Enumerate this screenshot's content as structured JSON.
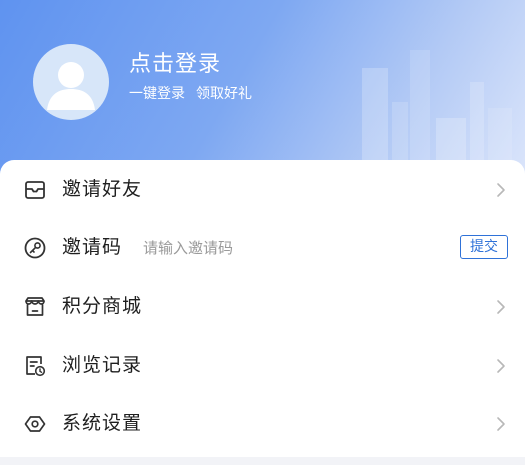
{
  "header": {
    "title": "点击登录",
    "subtitle_left": "一键登录",
    "subtitle_right": "领取好礼",
    "gradient_start": "#5f93f0",
    "gradient_end": "#dbe5fb"
  },
  "avatar": {
    "icon": "user-placeholder-icon"
  },
  "menu": {
    "items": [
      {
        "label": "邀请好友",
        "icon": "envelope-icon",
        "chevron": true
      },
      {
        "label": "邀请码",
        "icon": "key-icon",
        "input_placeholder": "请输入邀请码",
        "input_value": "",
        "button_label": "提交"
      },
      {
        "label": "积分商城",
        "icon": "shop-icon",
        "chevron": true
      },
      {
        "label": "浏览记录",
        "icon": "history-icon",
        "chevron": true
      },
      {
        "label": "系统设置",
        "icon": "settings-icon",
        "chevron": true
      }
    ]
  },
  "colors": {
    "accent": "#2f72d8",
    "text": "#1f1f1f",
    "placeholder": "#9a9a9a",
    "chevron": "#b8b8b8"
  }
}
